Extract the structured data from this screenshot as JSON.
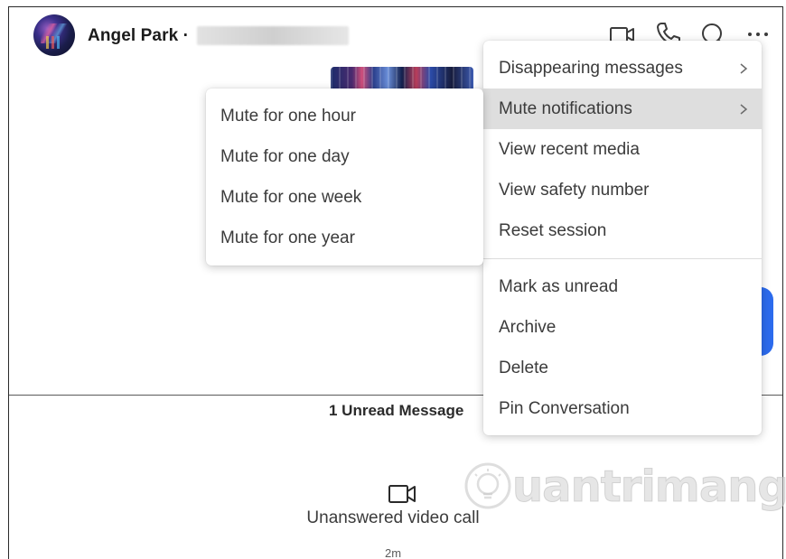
{
  "header": {
    "contact_name": "Angel Park ·",
    "icons": [
      "video-call-icon",
      "phone-icon",
      "search-icon",
      "more-icon"
    ]
  },
  "conversation": {
    "unread_label": "1 Unread Message",
    "call_label": "Unanswered video call",
    "call_time": "2m"
  },
  "menu": {
    "items": [
      {
        "label": "Disappearing messages",
        "has_submenu": true
      },
      {
        "label": "Mute notifications",
        "has_submenu": true,
        "active": true
      },
      {
        "label": "View recent media"
      },
      {
        "label": "View safety number"
      },
      {
        "label": "Reset session"
      },
      {
        "label": "Mark as unread"
      },
      {
        "label": "Archive"
      },
      {
        "label": "Delete"
      },
      {
        "label": "Pin Conversation"
      }
    ]
  },
  "submenu": {
    "items": [
      {
        "label": "Mute for one hour"
      },
      {
        "label": "Mute for one day"
      },
      {
        "label": "Mute for one week"
      },
      {
        "label": "Mute for one year"
      }
    ]
  },
  "watermark": {
    "text": "uantrimang"
  },
  "colors": {
    "accent": "#2c6bed",
    "menu_active": "#dedede"
  }
}
